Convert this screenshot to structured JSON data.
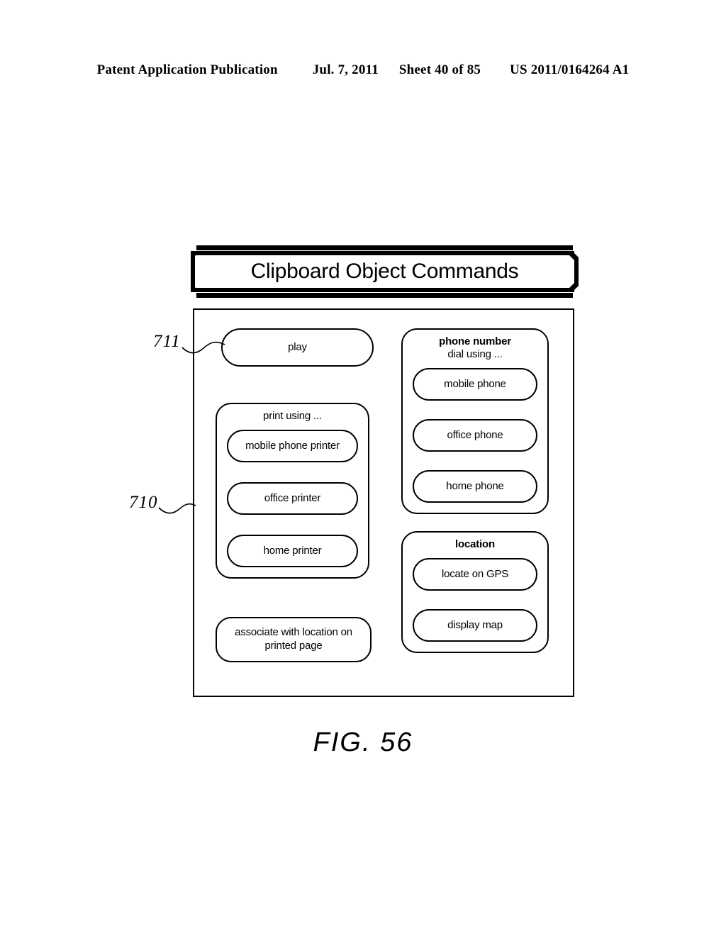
{
  "page_header": {
    "publication": "Patent Application Publication",
    "date": "Jul. 7, 2011",
    "sheet": "Sheet 40 of 85",
    "patent_number": "US 2011/0164264 A1"
  },
  "banner": {
    "title": "Clipboard Object Commands"
  },
  "references": {
    "upper": "711",
    "lower": "710"
  },
  "left_column": {
    "play_button": "play",
    "print_group": {
      "title": "print using ...",
      "options": [
        "mobile phone printer",
        "office printer",
        "home printer"
      ]
    },
    "associate_button": "associate with location on printed page"
  },
  "right_column": {
    "phone_group": {
      "title": "phone number",
      "subtitle": "dial using ...",
      "options": [
        "mobile phone",
        "office phone",
        "home phone"
      ]
    },
    "location_group": {
      "title": "location",
      "options": [
        "locate on GPS",
        "display map"
      ]
    }
  },
  "figure_caption": "FIG. 56",
  "colors": {
    "ink": "#000000",
    "paper": "#ffffff"
  }
}
